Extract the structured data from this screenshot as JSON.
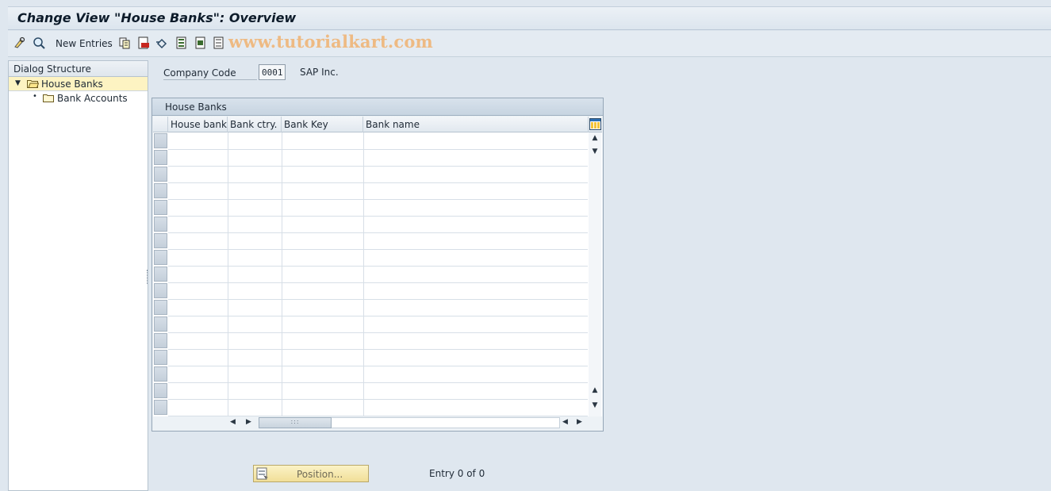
{
  "window": {
    "title": "Change View \"House Banks\": Overview"
  },
  "toolbar": {
    "new_entries_label": "New Entries",
    "watermark": "www.tutorialkart.com",
    "icons": [
      "edit-glasses-icon",
      "find-icon",
      "copy-icon",
      "delete-icon",
      "undo-icon",
      "select-all-icon",
      "select-block-icon",
      "deselect-all-icon"
    ]
  },
  "sidebar": {
    "header": "Dialog Structure",
    "items": [
      {
        "label": "House Banks",
        "selected": true,
        "expanded": true
      },
      {
        "label": "Bank Accounts",
        "selected": false
      }
    ]
  },
  "form": {
    "company_code_label": "Company Code",
    "company_code_value": "0001",
    "company_name": "SAP Inc."
  },
  "table": {
    "caption": "House Banks",
    "columns": [
      "House bank",
      "Bank ctry.",
      "Bank Key",
      "Bank name"
    ],
    "rows": []
  },
  "footer": {
    "position_button": "Position...",
    "entry_info": "Entry 0 of 0"
  }
}
